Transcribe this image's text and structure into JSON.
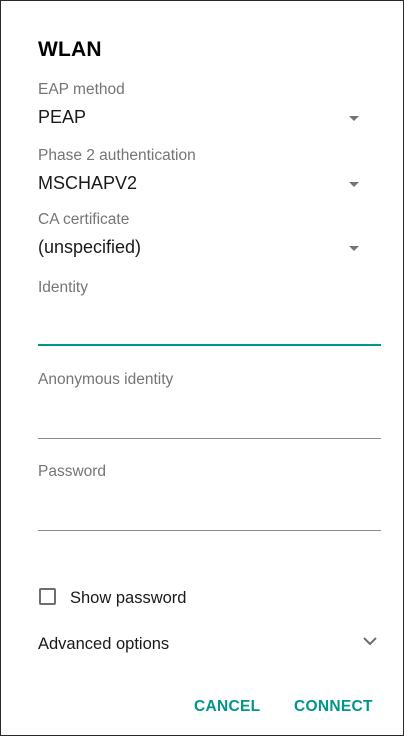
{
  "dialog": {
    "title": "WLAN"
  },
  "fields": {
    "eap_method": {
      "label": "EAP method",
      "value": "PEAP"
    },
    "phase2": {
      "label": "Phase 2 authentication",
      "value": "MSCHAPV2"
    },
    "ca_cert": {
      "label": "CA certificate",
      "value": "(unspecified)"
    },
    "identity": {
      "label": "Identity",
      "value": ""
    },
    "anonymous_identity": {
      "label": "Anonymous identity",
      "value": ""
    },
    "password": {
      "label": "Password",
      "value": ""
    }
  },
  "show_password": {
    "label": "Show password",
    "checked": false
  },
  "advanced": {
    "label": "Advanced options",
    "icon": "chevron-down-icon"
  },
  "buttons": {
    "cancel": "CANCEL",
    "connect": "CONNECT"
  },
  "colors": {
    "accent": "#009688",
    "label_gray": "#757575",
    "text": "#1a1a1a"
  }
}
